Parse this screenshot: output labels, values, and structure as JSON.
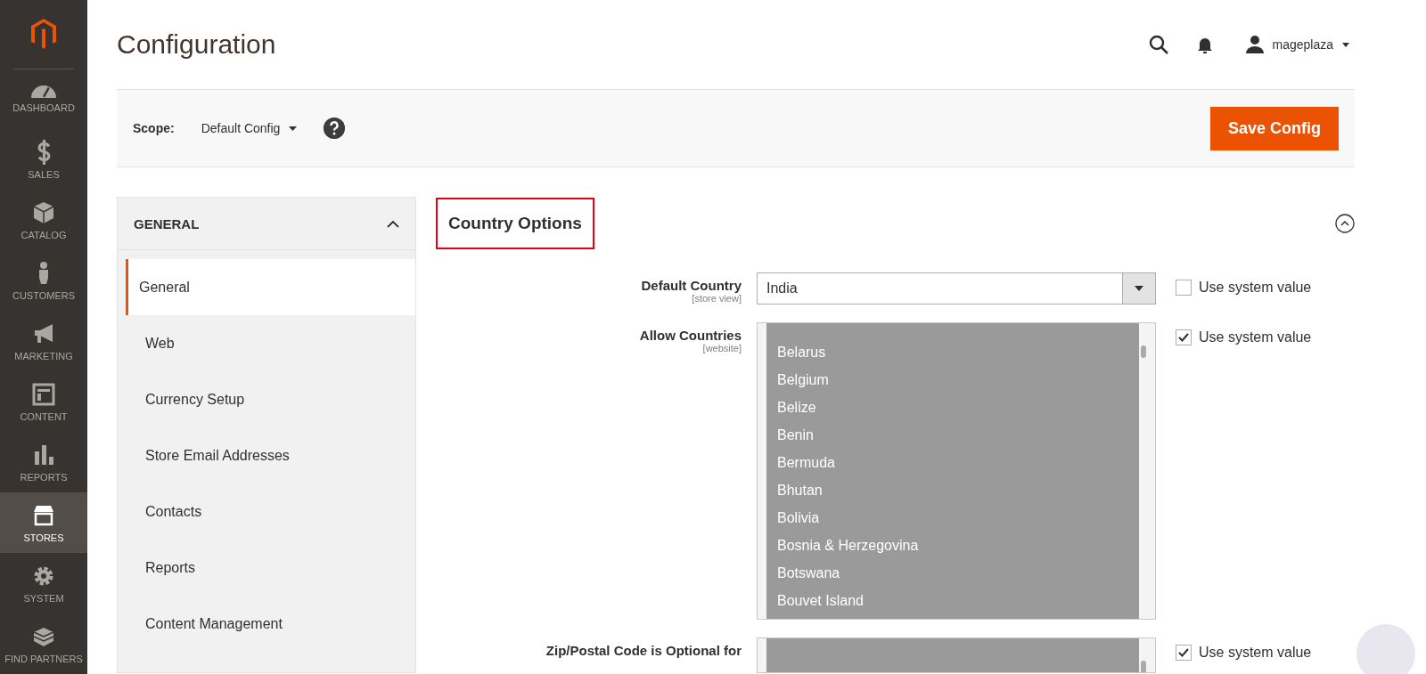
{
  "nav": [
    {
      "label": "DASHBOARD",
      "selected": false
    },
    {
      "label": "SALES",
      "selected": false
    },
    {
      "label": "CATALOG",
      "selected": false
    },
    {
      "label": "CUSTOMERS",
      "selected": false
    },
    {
      "label": "MARKETING",
      "selected": false
    },
    {
      "label": "CONTENT",
      "selected": false
    },
    {
      "label": "REPORTS",
      "selected": false
    },
    {
      "label": "STORES",
      "selected": true
    },
    {
      "label": "SYSTEM",
      "selected": false
    },
    {
      "label": "FIND PARTNERS",
      "selected": false
    }
  ],
  "header": {
    "title": "Configuration",
    "user": "mageplaza"
  },
  "scope_bar": {
    "label": "Scope:",
    "value": "Default Config",
    "button": "Save Config"
  },
  "config_tabs": {
    "title": "GENERAL",
    "expanded": true,
    "items": [
      {
        "label": "General",
        "selected": true
      },
      {
        "label": "Web",
        "selected": false
      },
      {
        "label": "Currency Setup",
        "selected": false
      },
      {
        "label": "Store Email Addresses",
        "selected": false
      },
      {
        "label": "Contacts",
        "selected": false
      },
      {
        "label": "Reports",
        "selected": false
      },
      {
        "label": "Content Management",
        "selected": false
      }
    ]
  },
  "section": {
    "title": "Country Options",
    "highlighted": true,
    "expanded": true,
    "fields": [
      {
        "kind": "select",
        "label": "Default Country",
        "scope": "[store view]",
        "value": "India",
        "use_system_label": "Use system value",
        "use_system": false
      },
      {
        "kind": "multiselect",
        "label": "Allow Countries",
        "scope": "[website]",
        "options": [
          "Belarus",
          "Belgium",
          "Belize",
          "Benin",
          "Bermuda",
          "Bhutan",
          "Bolivia",
          "Bosnia & Herzegovina",
          "Botswana",
          "Bouvet Island"
        ],
        "use_system_label": "Use system value",
        "use_system": true
      },
      {
        "kind": "multiselect",
        "label": "Zip/Postal Code is Optional for",
        "use_system_label": "Use system value",
        "use_system": true
      }
    ]
  }
}
